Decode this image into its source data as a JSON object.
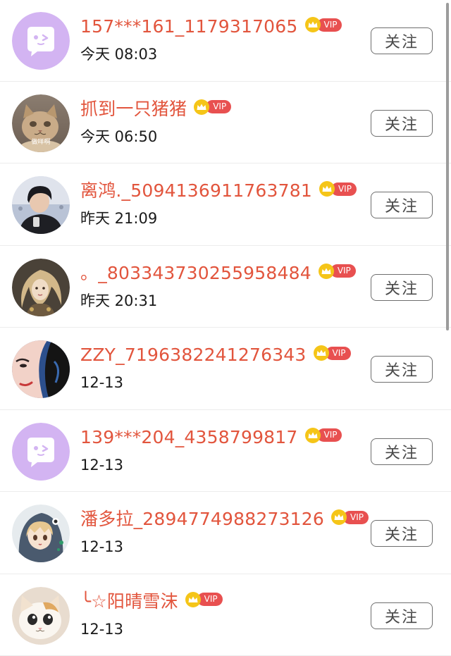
{
  "follow_list": {
    "follow_label": "关注",
    "vip_label": "VIP",
    "items": [
      {
        "name": "157***161_1179317065",
        "time": "今天 08:03",
        "avatar": "default-chat-bubble-avatar"
      },
      {
        "name": "抓到一只猪猪",
        "time": "今天 06:50",
        "avatar": "cat-photo-avatar",
        "avatar_caption": "做咩啊"
      },
      {
        "name": "离鸿._5094136911763781",
        "time": "昨天 21:09",
        "avatar": "person-photo-avatar"
      },
      {
        "name": "。_803343730255958484",
        "time": "昨天 20:31",
        "avatar": "illustrated-girl-avatar"
      },
      {
        "name": "ZZY_7196382241276343",
        "time": "12-13",
        "avatar": "illustrated-face-avatar"
      },
      {
        "name": "139***204_4358799817",
        "time": "12-13",
        "avatar": "default-chat-bubble-avatar"
      },
      {
        "name": "潘多拉_2894774988273126",
        "time": "12-13",
        "avatar": "anime-girl-avatar"
      },
      {
        "name": "╰☆阳晴雪沫",
        "time": "12-13",
        "avatar": "kitten-photo-avatar"
      }
    ]
  },
  "colors": {
    "name": "#e2553d",
    "vip_pill": "#e85050",
    "crown": "#f5c518",
    "default_avatar": "#d3b4f2"
  }
}
